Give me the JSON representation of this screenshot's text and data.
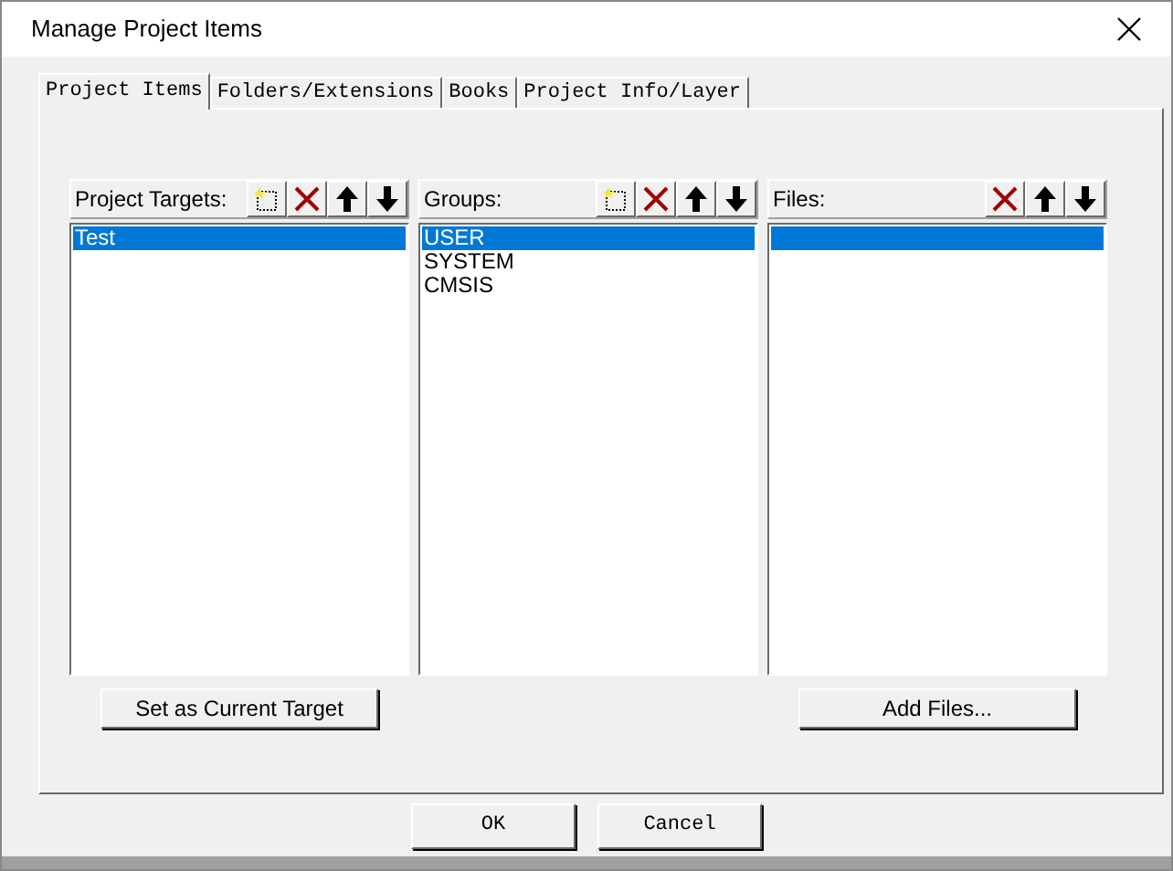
{
  "window": {
    "title": "Manage Project Items"
  },
  "tabs": [
    {
      "label": "Project Items",
      "selected": true
    },
    {
      "label": "Folders/Extensions",
      "selected": false
    },
    {
      "label": "Books",
      "selected": false
    },
    {
      "label": "Project Info/Layer",
      "selected": false
    }
  ],
  "panes": [
    {
      "label": "Project Targets:",
      "tools": [
        {
          "kind": "new"
        },
        {
          "kind": "delete"
        },
        {
          "kind": "up"
        },
        {
          "kind": "down"
        }
      ],
      "items": [
        {
          "text": "Test",
          "selected": true
        }
      ],
      "empty_selected_row": false,
      "button": "Set as Current Target"
    },
    {
      "label": "Groups:",
      "tools": [
        {
          "kind": "new"
        },
        {
          "kind": "delete"
        },
        {
          "kind": "up"
        },
        {
          "kind": "down"
        }
      ],
      "items": [
        {
          "text": "USER",
          "selected": true
        },
        {
          "text": "SYSTEM",
          "selected": false
        },
        {
          "text": "CMSIS",
          "selected": false
        }
      ],
      "empty_selected_row": false
    },
    {
      "label": "Files:",
      "tools": [
        {
          "kind": "delete"
        },
        {
          "kind": "up"
        },
        {
          "kind": "down"
        }
      ],
      "empty_selected_row": true,
      "button": "Add Files..."
    }
  ],
  "footer_buttons": [
    "OK",
    "Cancel"
  ]
}
